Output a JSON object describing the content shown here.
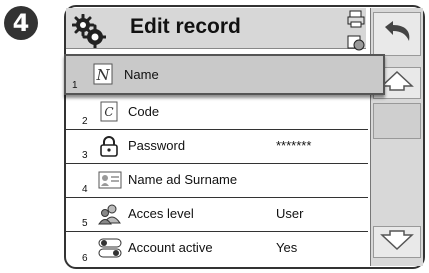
{
  "step_badge": "4",
  "header": {
    "title": "Edit record",
    "icons": [
      "gears-icon",
      "printer-icon",
      "export-icon"
    ]
  },
  "controls": {
    "undo_icon": "undo-arrow-icon",
    "up_icon": "arrow-up-icon",
    "down_icon": "arrow-down-icon"
  },
  "rows": [
    {
      "num": "1",
      "icon": "name-icon",
      "label": "Name",
      "value": "",
      "selected": true
    },
    {
      "num": "2",
      "icon": "code-icon",
      "label": "Code",
      "value": ""
    },
    {
      "num": "3",
      "icon": "lock-icon",
      "label": "Password",
      "value": "*******"
    },
    {
      "num": "4",
      "icon": "id-card-icon",
      "label": "Name ad Surname",
      "value": ""
    },
    {
      "num": "5",
      "icon": "users-icon",
      "label": "Acces level",
      "value": "User"
    },
    {
      "num": "6",
      "icon": "toggle-icon",
      "label": "Account active",
      "value": "Yes"
    }
  ],
  "colors": {
    "title_bg": "#d7d7d7",
    "selected_bg": "#c9c9c9",
    "side_panel": "#d8d8d8",
    "badge": "#333333"
  }
}
